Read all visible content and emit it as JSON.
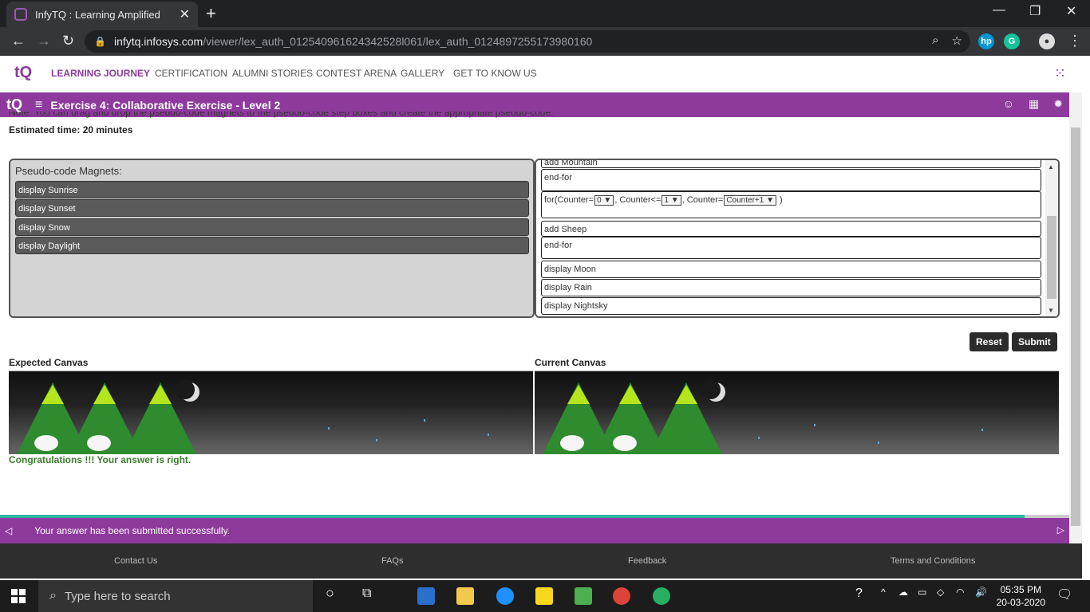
{
  "browser": {
    "tab_title": "InfyTQ : Learning Amplified",
    "url_host": "infytq.infosys.com",
    "url_path": "/viewer/lex_auth_012540961624342528l061/lex_auth_0124897255173980160"
  },
  "nav": {
    "items": [
      "LEARNING JOURNEY",
      "CERTIFICATION",
      "ALUMNI STORIES",
      "CONTEST ARENA",
      "GALLERY",
      "GET TO KNOW US"
    ]
  },
  "exercise": {
    "title": "Exercise 4: Collaborative Exercise - Level 2",
    "note": "Note: You can drag and drop the pseudo-code magnets to the pseudo-code step boxes and create the appropriate pseudo-code.",
    "estimated_time": "Estimated time: 20 minutes"
  },
  "magnets": {
    "title": "Pseudo-code Magnets:",
    "items": [
      "display Sunrise",
      "display Sunset",
      "display Snow",
      "display Daylight"
    ]
  },
  "steps": {
    "items": [
      "add Mountain",
      "end-for",
      "add Sheep",
      "end-for",
      "display Moon",
      "display Rain",
      "display Nightsky"
    ],
    "for_loop": {
      "prefix": "for(Counter=",
      "start": "0",
      "mid": ", Counter<=",
      "end": "1",
      "mid2": ", Counter=",
      "step": "Counter+1",
      "suffix": " )"
    }
  },
  "buttons": {
    "reset": "Reset",
    "submit": "Submit"
  },
  "canvas": {
    "expected_label": "Expected Canvas",
    "current_label": "Current Canvas",
    "result": "Congratulations !!! Your answer is right."
  },
  "status": {
    "message": "Your answer has been submitted successfully."
  },
  "footer": {
    "links": [
      "Contact Us",
      "FAQs",
      "Feedback",
      "Terms and Conditions"
    ]
  },
  "taskbar": {
    "search_placeholder": "Type here to search",
    "time": "05:35 PM",
    "date": "20-03-2020"
  },
  "colors": {
    "brand": "#8e3a9d",
    "teal": "#2cb5a5",
    "success": "#3a7d2c"
  }
}
